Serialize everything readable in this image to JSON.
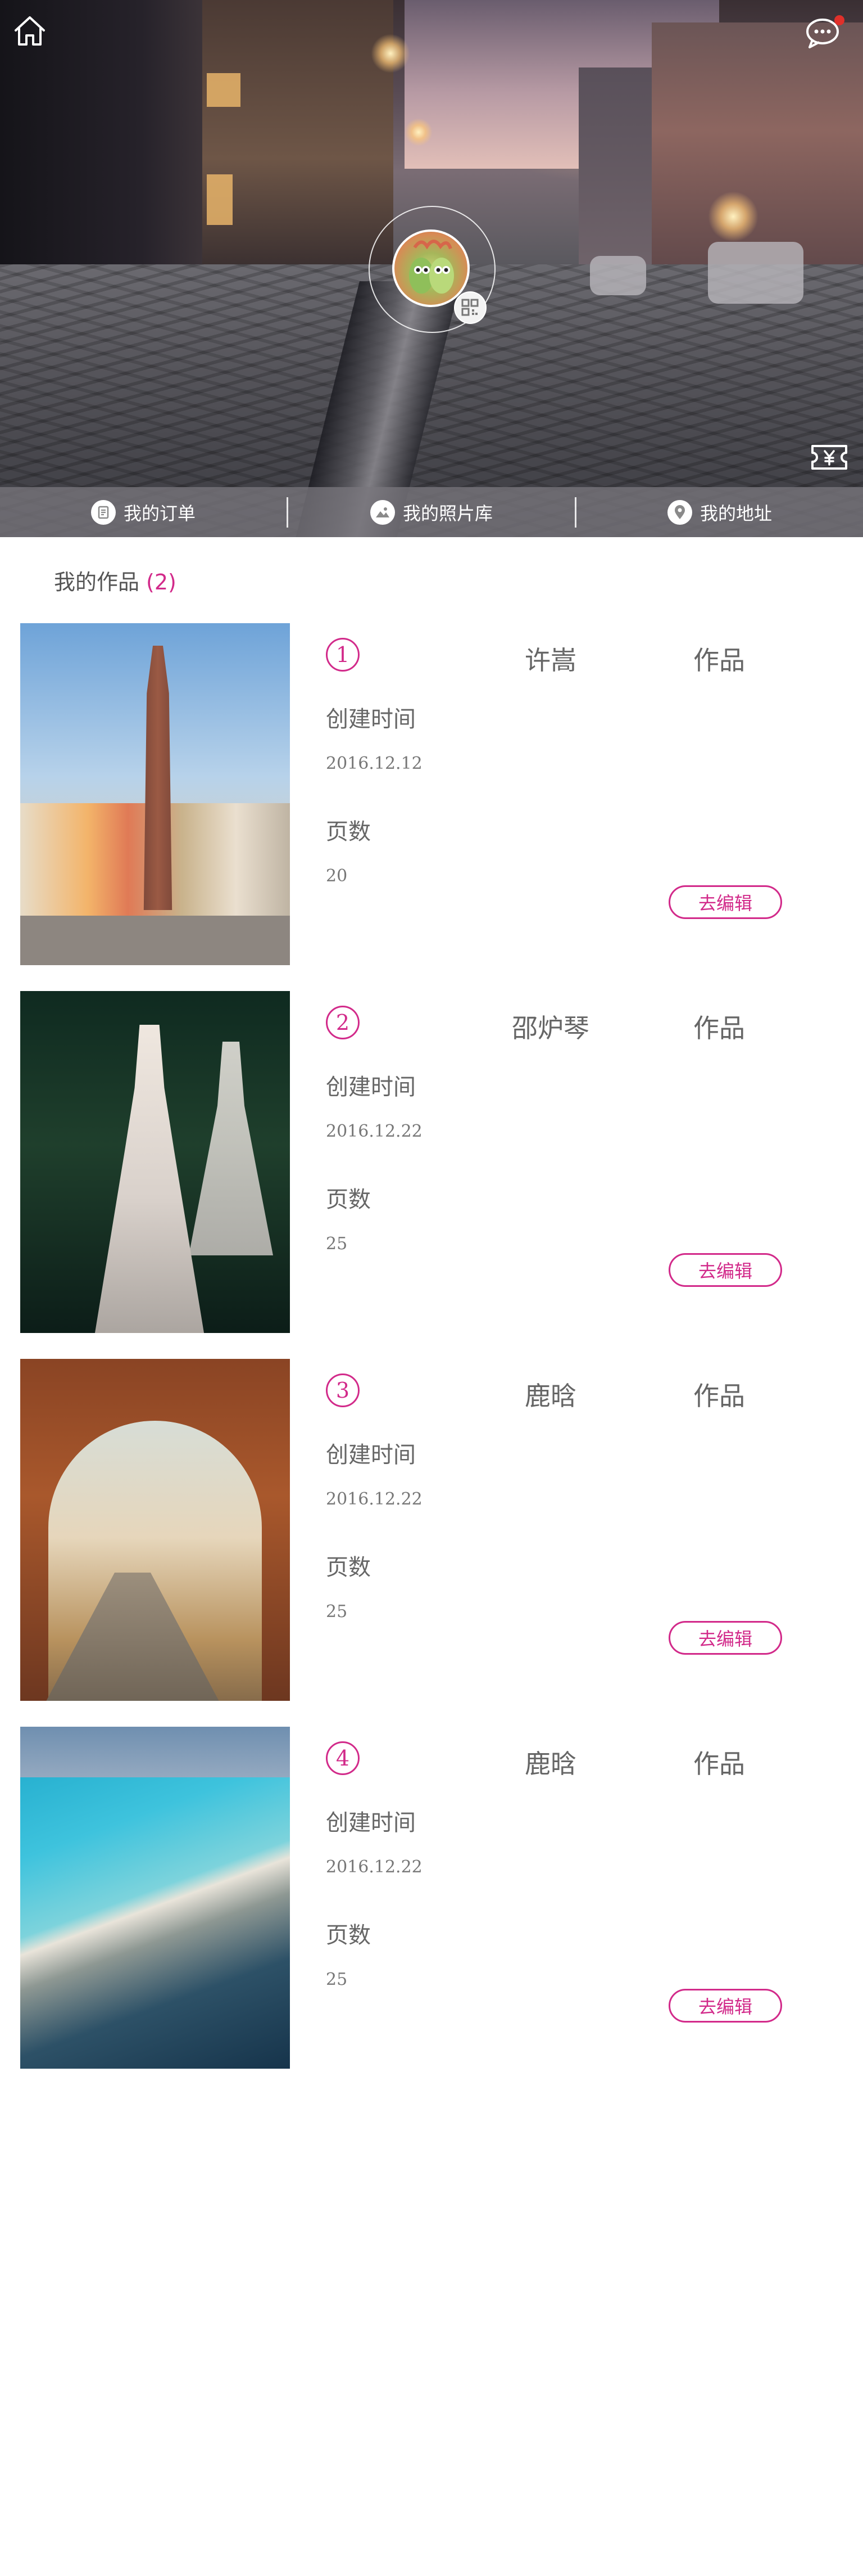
{
  "nav": {
    "items": [
      {
        "label": "我的订单",
        "icon": "order-icon"
      },
      {
        "label": "我的照片库",
        "icon": "photo-library-icon"
      },
      {
        "label": "我的地址",
        "icon": "location-icon"
      }
    ]
  },
  "header": {
    "home_icon": "home-icon",
    "chat_icon": "chat-icon",
    "ticket_icon": "ticket-yen-icon",
    "qr_icon": "qrcode-icon",
    "notification_color": "#e0302a"
  },
  "section": {
    "title": "我的作品",
    "count": "(2)"
  },
  "accent_color": "#d22a8a",
  "works": [
    {
      "num": "1",
      "author": "许嵩",
      "tag": "作品",
      "created_label": "创建时间",
      "created": "2016.12.12",
      "pages_label": "页数",
      "pages": "20",
      "edit_label": "去编辑"
    },
    {
      "num": "2",
      "author": "邵炉琴",
      "tag": "作品",
      "created_label": "创建时间",
      "created": "2016.12.22",
      "pages_label": "页数",
      "pages": "25",
      "edit_label": "去编辑"
    },
    {
      "num": "3",
      "author": "鹿晗",
      "tag": "作品",
      "created_label": "创建时间",
      "created": "2016.12.22",
      "pages_label": "页数",
      "pages": "25",
      "edit_label": "去编辑"
    },
    {
      "num": "4",
      "author": "鹿晗",
      "tag": "作品",
      "created_label": "创建时间",
      "created": "2016.12.22",
      "pages_label": "页数",
      "pages": "25",
      "edit_label": "去编辑"
    }
  ]
}
